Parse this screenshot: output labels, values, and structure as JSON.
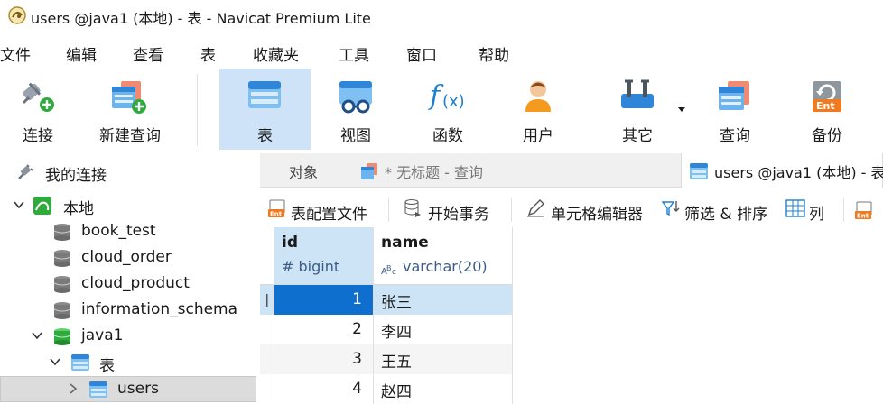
{
  "window": {
    "title": "users @java1 (本地) - 表 - Navicat Premium Lite"
  },
  "menu": [
    "文件",
    "编辑",
    "查看",
    "表",
    "收藏夹",
    "工具",
    "窗口",
    "帮助"
  ],
  "toolbar": {
    "items": [
      {
        "label": "连接",
        "icon": "plug-add-icon"
      },
      {
        "label": "新建查询",
        "icon": "new-query-icon"
      },
      {
        "label": "表",
        "icon": "table-icon"
      },
      {
        "label": "视图",
        "icon": "view-glasses-icon"
      },
      {
        "label": "函数",
        "icon": "function-fx-icon"
      },
      {
        "label": "用户",
        "icon": "user-icon"
      },
      {
        "label": "其它",
        "icon": "tools-icon"
      },
      {
        "label": "查询",
        "icon": "query-icon"
      },
      {
        "label": "备份",
        "icon": "backup-icon"
      }
    ],
    "active": "表"
  },
  "sidebar": {
    "header": "我的连接",
    "connection": "本地",
    "databases": [
      "book_test",
      "cloud_order",
      "cloud_product",
      "information_schema",
      "java1"
    ],
    "folder": "表",
    "selected_table": "users"
  },
  "tabs": [
    {
      "label": "对象"
    },
    {
      "label": "* 无标题 - 查询"
    },
    {
      "label": "users @java1 (本地) - 表"
    }
  ],
  "object_toolbar": [
    "表配置文件",
    "开始事务",
    "单元格编辑器",
    "筛选 & 排序",
    "列"
  ],
  "grid": {
    "columns": [
      {
        "name": "id",
        "type": "# bigint"
      },
      {
        "name": "name",
        "type": "varchar(20)"
      }
    ],
    "rows": [
      {
        "id": "1",
        "name": "张三"
      },
      {
        "id": "2",
        "name": "李四"
      },
      {
        "id": "3",
        "name": "王五"
      },
      {
        "id": "4",
        "name": "赵四"
      }
    ]
  },
  "colors": {
    "accent": "#0f6fcf",
    "selection": "#cde4f7",
    "active_toolbar": "#cfe3f8"
  }
}
